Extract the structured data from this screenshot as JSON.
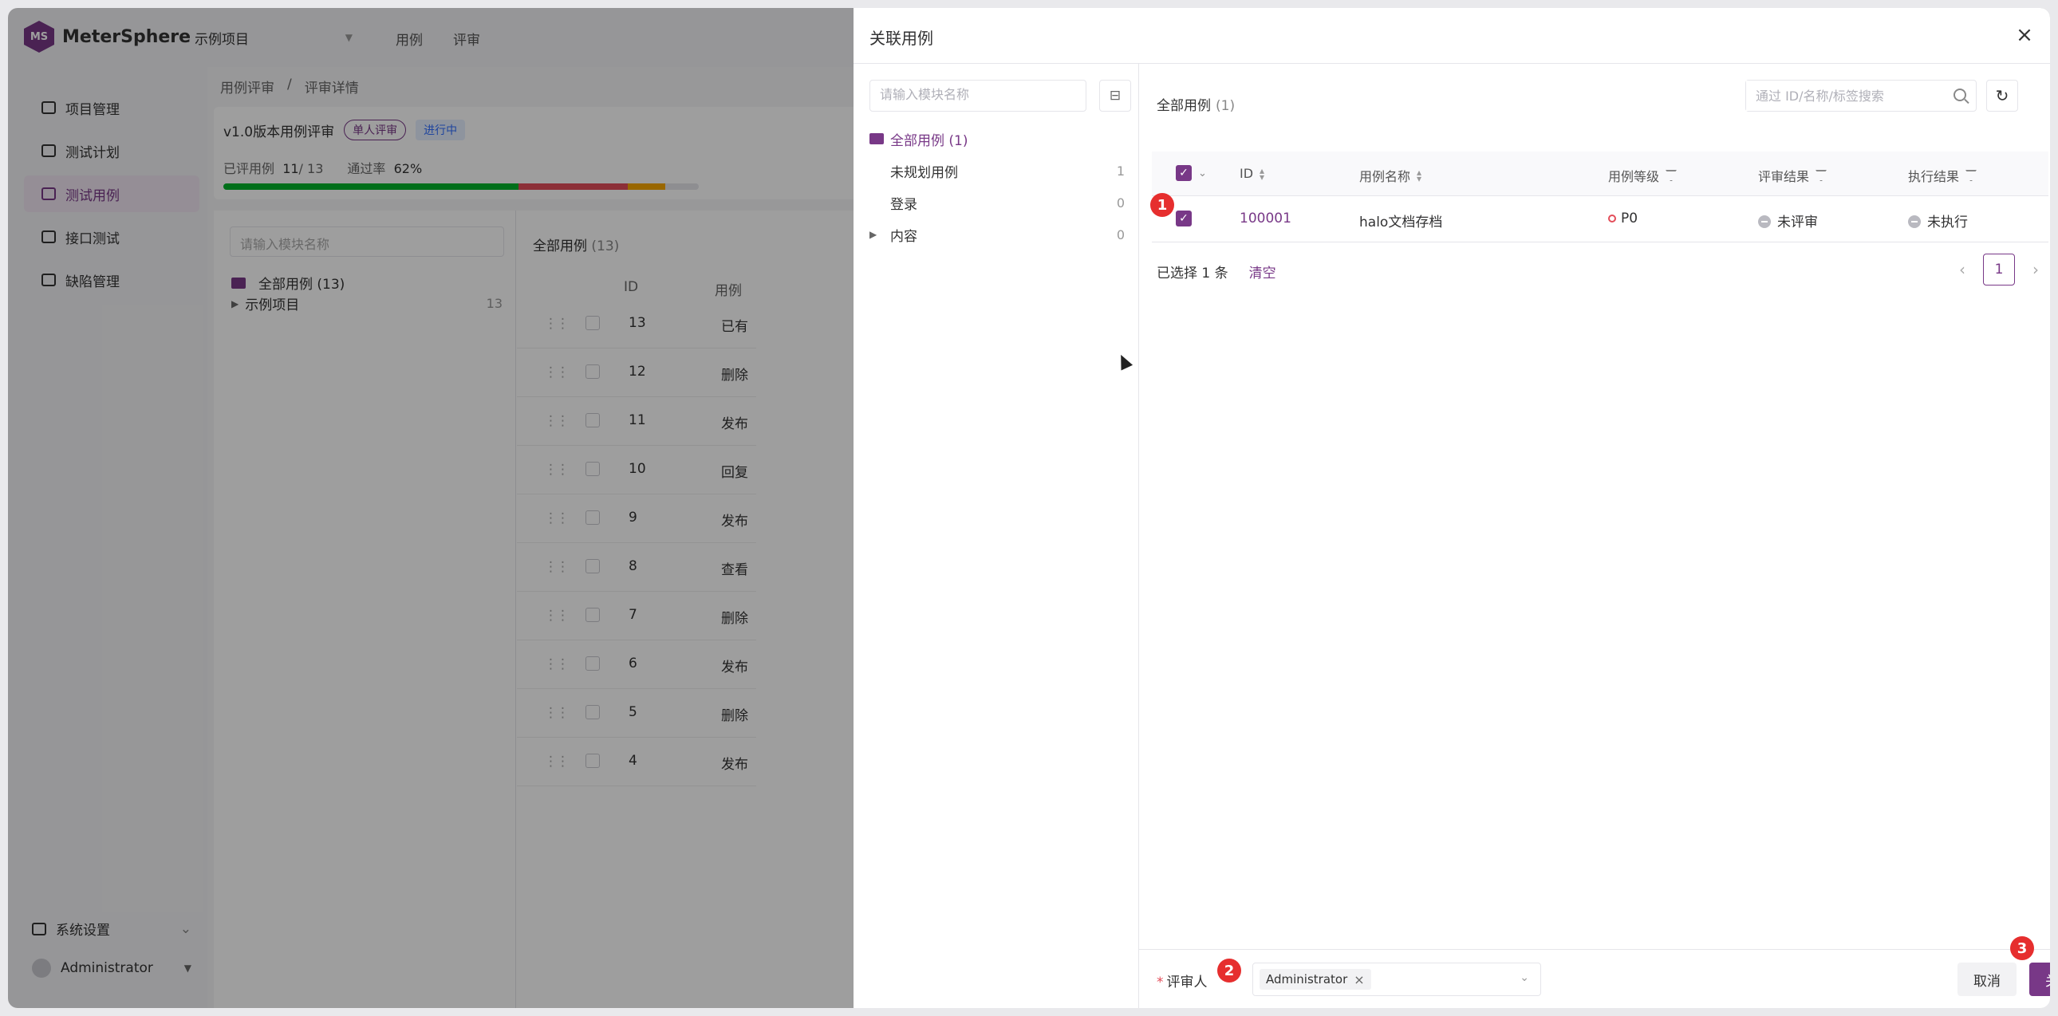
{
  "app": {
    "brand": "MeterSphere",
    "logo_mark": "MS",
    "project": "示例项目",
    "top_tabs": [
      "用例",
      "评审"
    ],
    "sidebar": [
      {
        "label": "项目管理",
        "icon": "project-icon"
      },
      {
        "label": "测试计划",
        "icon": "plan-icon"
      },
      {
        "label": "测试用例",
        "icon": "case-icon",
        "active": true
      },
      {
        "label": "接口测试",
        "icon": "api-icon"
      },
      {
        "label": "缺陷管理",
        "icon": "bug-icon"
      }
    ],
    "settings_label": "系统设置",
    "user_label": "Administrator",
    "breadcrumb": [
      "用例评审",
      "/",
      "评审详情"
    ],
    "review": {
      "title": "v1.0版本用例评审",
      "mode_chip": "单人评审",
      "status_chip": "进行中",
      "reviewed_label": "已评用例",
      "reviewed_value": "11",
      "reviewed_total": "/ 13",
      "pass_label": "通过率",
      "pass_value": "62%",
      "progress": [
        {
          "fraction": 0.62,
          "color": "#00b42a"
        },
        {
          "fraction": 0.23,
          "color": "#e34d59"
        },
        {
          "fraction": 0.08,
          "color": "#f7a600"
        }
      ]
    },
    "bg_tree": {
      "search_placeholder": "请输入模块名称",
      "all_label": "全部用例 (13)",
      "project_label": "示例项目",
      "project_count": "13"
    },
    "bg_table": {
      "all_label": "全部用例",
      "all_count": "(13)",
      "col_id": "ID",
      "col_name": "用例",
      "rows": [
        {
          "id": "13",
          "name": "已有"
        },
        {
          "id": "12",
          "name": "删除"
        },
        {
          "id": "11",
          "name": "发布"
        },
        {
          "id": "10",
          "name": "回复"
        },
        {
          "id": "9",
          "name": "发布"
        },
        {
          "id": "8",
          "name": "查看"
        },
        {
          "id": "7",
          "name": "删除"
        },
        {
          "id": "6",
          "name": "发布"
        },
        {
          "id": "5",
          "name": "删除"
        },
        {
          "id": "4",
          "name": "发布"
        }
      ]
    }
  },
  "drawer": {
    "title": "关联用例",
    "module_search_placeholder": "请输入模块名称",
    "tree": [
      {
        "label": "全部用例 (1)",
        "count": "",
        "kind": "root"
      },
      {
        "label": "未规划用例",
        "count": "1",
        "kind": "leaf"
      },
      {
        "label": "登录",
        "count": "0",
        "kind": "leaf"
      },
      {
        "label": "内容",
        "count": "0",
        "kind": "branch"
      }
    ],
    "all_label": "全部用例",
    "all_count": "(1)",
    "search_placeholder": "通过 ID/名称/标签搜索",
    "columns": {
      "id": "ID",
      "name": "用例名称",
      "level": "用例等级",
      "review_result": "评审结果",
      "exec_result": "执行结果"
    },
    "rows": [
      {
        "id": "100001",
        "name": "halo文档存档",
        "level": "P0",
        "review_result": "未评审",
        "exec_result": "未执行",
        "checked": true
      }
    ],
    "selected_text": "已选择 1 条",
    "clear_label": "清空",
    "page": "1",
    "reviewer_label": "评审人",
    "reviewer_tag": "Administrator",
    "cancel_label": "取消",
    "confirm_label": "关联",
    "badges": [
      "1",
      "2",
      "3"
    ],
    "colors": {
      "primary": "#783887",
      "danger": "#e34d59",
      "badge": "#e62e2e"
    }
  }
}
